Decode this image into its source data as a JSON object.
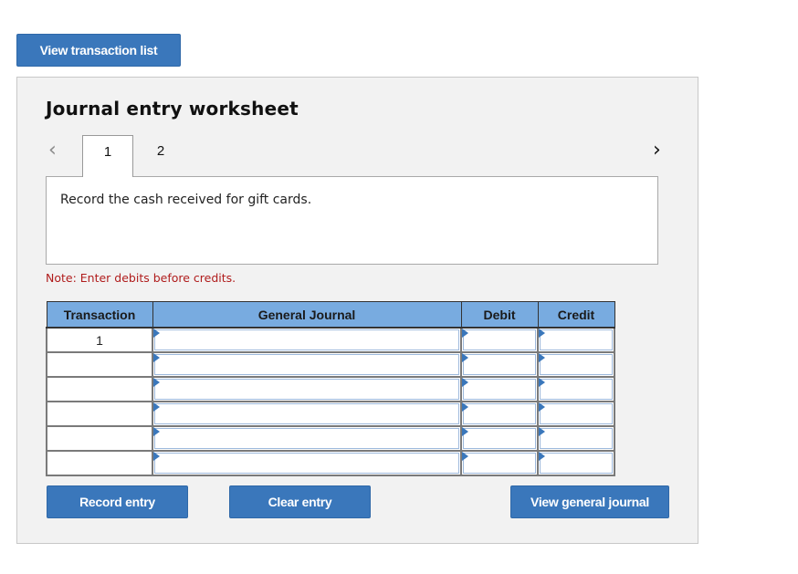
{
  "top_button": {
    "label": "View transaction list"
  },
  "worksheet": {
    "title": "Journal entry worksheet",
    "nav": {
      "prev_icon": "‹",
      "next_icon": "›"
    },
    "tabs": [
      {
        "label": "1",
        "active": true
      },
      {
        "label": "2",
        "active": false
      }
    ],
    "prompt": "Record the cash received for gift cards.",
    "note": "Note: Enter debits before credits.",
    "table": {
      "headers": [
        "Transaction",
        "General Journal",
        "Debit",
        "Credit"
      ],
      "rows": [
        {
          "transaction": "1",
          "account": "",
          "debit": "",
          "credit": ""
        },
        {
          "transaction": "",
          "account": "",
          "debit": "",
          "credit": ""
        },
        {
          "transaction": "",
          "account": "",
          "debit": "",
          "credit": ""
        },
        {
          "transaction": "",
          "account": "",
          "debit": "",
          "credit": ""
        },
        {
          "transaction": "",
          "account": "",
          "debit": "",
          "credit": ""
        },
        {
          "transaction": "",
          "account": "",
          "debit": "",
          "credit": ""
        }
      ]
    },
    "buttons": {
      "record": "Record entry",
      "clear": "Clear entry",
      "view_journal": "View general journal"
    }
  },
  "colors": {
    "button_blue": "#3a77bb",
    "header_blue": "#78abe0",
    "note_red": "#b01c1c",
    "panel_bg": "#f2f2f2"
  }
}
